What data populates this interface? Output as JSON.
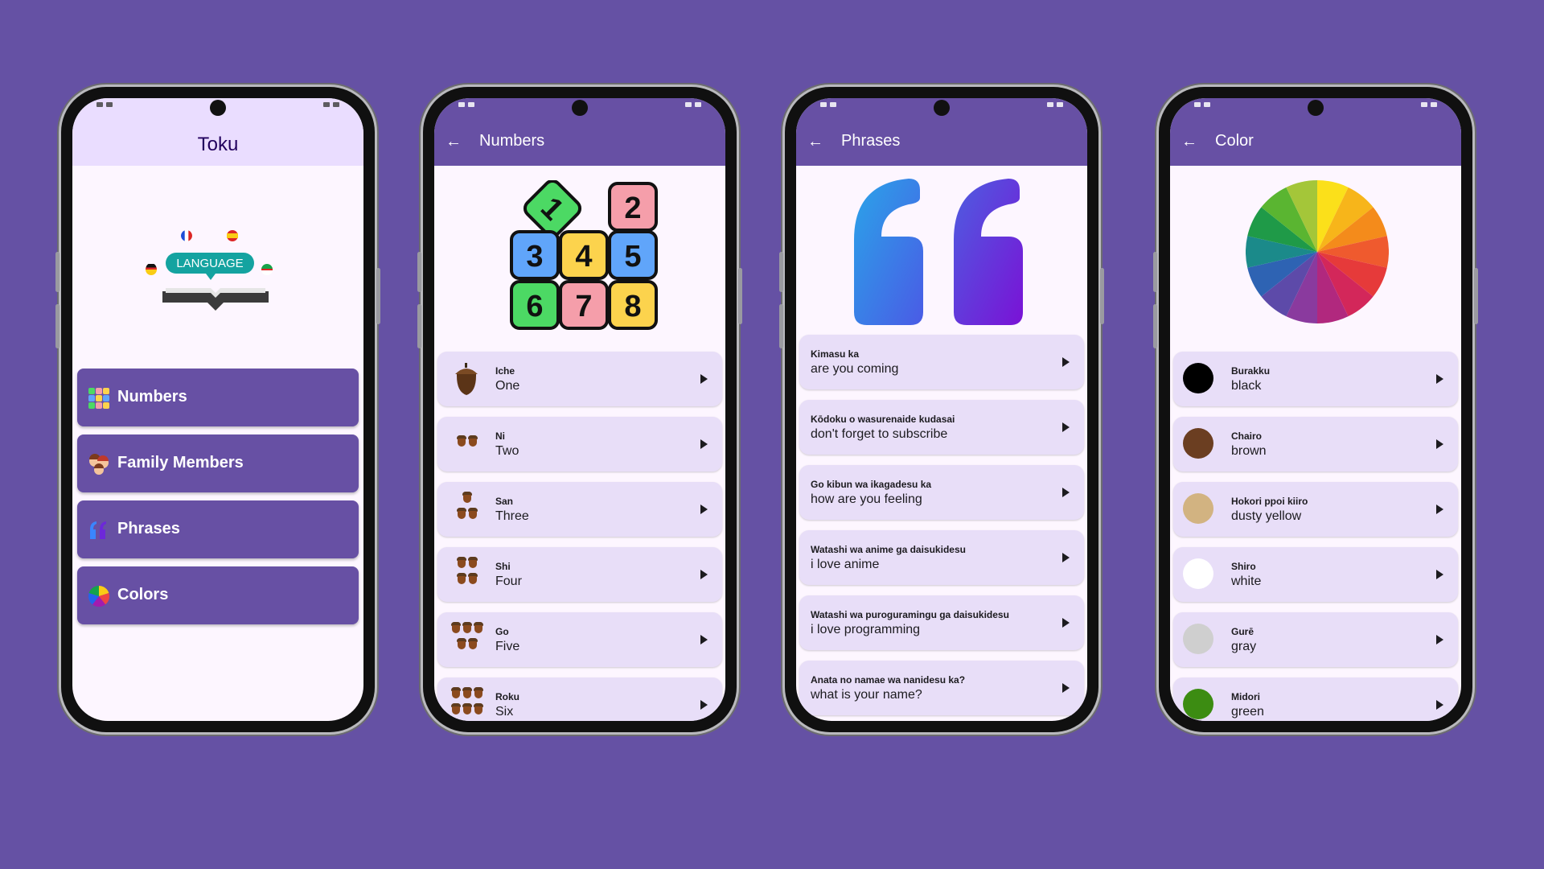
{
  "phone1": {
    "title": "Toku",
    "illustration_label": "LANGUAGE",
    "menu": [
      {
        "label": "Numbers",
        "icon": "number-blocks-icon"
      },
      {
        "label": "Family Members",
        "icon": "family-icon"
      },
      {
        "label": "Phrases",
        "icon": "quote-icon"
      },
      {
        "label": "Colors",
        "icon": "color-wheel-icon"
      }
    ]
  },
  "phone2": {
    "title": "Numbers",
    "hero_digits": [
      "1",
      "2",
      "3",
      "4",
      "5",
      "6",
      "7",
      "8"
    ],
    "items": [
      {
        "native": "Iche",
        "english": "One",
        "count": 1
      },
      {
        "native": "Ni",
        "english": "Two",
        "count": 2
      },
      {
        "native": "San",
        "english": "Three",
        "count": 3
      },
      {
        "native": "Shi",
        "english": "Four",
        "count": 4
      },
      {
        "native": "Go",
        "english": "Five",
        "count": 5
      },
      {
        "native": "Roku",
        "english": "Six",
        "count": 6
      }
    ]
  },
  "phone3": {
    "title": "Phrases",
    "items": [
      {
        "native": "Kimasu ka",
        "english": "are you coming"
      },
      {
        "native": "Kōdoku o wasurenaide kudasai",
        "english": "don't forget to subscribe"
      },
      {
        "native": "Go kibun wa ikagadesu ka",
        "english": "how are you feeling"
      },
      {
        "native": "Watashi wa anime ga daisukidesu",
        "english": "i love anime"
      },
      {
        "native": "Watashi wa puroguramingu ga daisukidesu",
        "english": "i love programming"
      },
      {
        "native": "Anata no namae wa nanidesu ka?",
        "english": "what is your name?"
      }
    ]
  },
  "phone4": {
    "title": "Color",
    "items": [
      {
        "native": "Burakku",
        "english": "black",
        "swatch": "#000000"
      },
      {
        "native": "Chairo",
        "english": "brown",
        "swatch": "#6b3e21"
      },
      {
        "native": "Hokori ppoi kiiro",
        "english": "dusty yellow",
        "swatch": "#d2b381"
      },
      {
        "native": "Shiro",
        "english": "white",
        "swatch": "#ffffff"
      },
      {
        "native": "Gurē",
        "english": "gray",
        "swatch": "#cfcfcf"
      },
      {
        "native": "Midori",
        "english": "green",
        "swatch": "#3c8c12"
      }
    ]
  },
  "colors": {
    "background": "#6551a4",
    "appbar": "#6750a4",
    "item": "#e8def8",
    "screen": "#fdf6ff"
  }
}
